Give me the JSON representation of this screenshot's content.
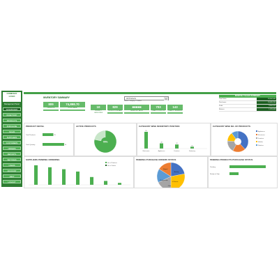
{
  "sidebar": {
    "logo_line1": "COMPANY",
    "logo_line2": "LOGO",
    "subtitle": "Management Panel",
    "items": [
      {
        "label": "DASHBOARD",
        "active": true
      },
      {
        "label": "INVENTORY"
      },
      {
        "label": "PRODUCTS"
      },
      {
        "label": "PURCHASE"
      },
      {
        "label": "SALES"
      },
      {
        "label": "SUPPLIERS"
      },
      {
        "label": "CUSTOMERS"
      },
      {
        "label": "ORDERS"
      },
      {
        "label": "REPORTS"
      },
      {
        "label": "SETTINGS"
      },
      {
        "label": "USERS"
      },
      {
        "label": "ACCOUNT"
      },
      {
        "label": "HELP"
      },
      {
        "label": "LOGOUT"
      }
    ]
  },
  "header": {
    "title": "INVENTORY SUMMARY",
    "select_value": "All Products",
    "select_sub": "Select Category / Product"
  },
  "kpis": [
    {
      "value": "809",
      "label": "PRODUCTS"
    },
    {
      "value": "74,898.70",
      "label": "STOCK VALUE"
    },
    {
      "value": "10",
      "label": "PRODUCT CATEGORIES"
    },
    {
      "value": "829",
      "label": "PRODUCTS ON HAND"
    },
    {
      "value": "■■■■■",
      "label": "INVENTORY VALUE"
    },
    {
      "value": "703",
      "label": "QUANTITY IN STOCK"
    },
    {
      "value": "143",
      "label": "QUANTITY RESERVED"
    }
  ],
  "summary": {
    "title": "MONTHLY SALES SUMMARY",
    "rows": [
      {
        "label": "Total Sales",
        "value": "28,484,346"
      },
      {
        "label": "Purchases",
        "value": "19,485,236"
      },
      {
        "label": "Profit",
        "value": "9,684,323"
      },
      {
        "label": "Returns",
        "value": "1,325,648"
      }
    ],
    "mini_label": "Trend"
  },
  "panels": {
    "product_detail": "PRODUCT DETAIL",
    "active_products": "ACTIVE PRODUCTS",
    "category_inventory": "CATEGORY WISE INVENTORY POSITION",
    "category_count": "CATEGORY WISE NO. OF PRODUCTS",
    "suppliers_pending": "SUPPLIERS PENDING ORDERING",
    "pending_purchase": "PENDING PURCHASE ORDERS STATUS",
    "pending_products": "PENDING PRODUCTS PURCHASE STATUS"
  },
  "chart_data": [
    {
      "type": "bar",
      "orientation": "horizontal",
      "title": "PRODUCT DETAIL",
      "categories": [
        "Total Products",
        "Total Quantity"
      ],
      "values": [
        25,
        50
      ],
      "xlim": [
        0,
        55
      ]
    },
    {
      "type": "pie",
      "title": "ACTIVE PRODUCTS",
      "labels": [
        "Active",
        "Inactive"
      ],
      "values": [
        78,
        22
      ],
      "center_label": "78%"
    },
    {
      "type": "bar",
      "title": "CATEGORY WISE INVENTORY POSITION",
      "categories": [
        "Electronics",
        "Appliances",
        "Furniture",
        "Stationery"
      ],
      "values": [
        90,
        28,
        22,
        10
      ]
    },
    {
      "type": "pie",
      "title": "CATEGORY WISE NO. OF PRODUCTS",
      "labels": [
        "Appliances",
        "Electronics",
        "Furniture",
        "Mobiles",
        "Watches"
      ],
      "values": [
        38,
        20,
        18,
        14,
        10
      ]
    },
    {
      "type": "bar",
      "title": "SUPPLIERS PENDING ORDERING",
      "series": [
        {
          "name": "No. of Products",
          "values": [
            100,
            90,
            80,
            68,
            40,
            20,
            10
          ]
        },
        {
          "name": "No. of Orders",
          "values": [
            0,
            0,
            0,
            0,
            0,
            0,
            0
          ]
        }
      ]
    },
    {
      "type": "pie",
      "title": "PENDING PURCHASE ORDERS STATUS",
      "labels": [
        "Shipped",
        "Awaiting",
        "Ready to ship",
        "In Process",
        "Other"
      ],
      "values": [
        22,
        28,
        18,
        16,
        16
      ]
    },
    {
      "type": "bar",
      "orientation": "horizontal",
      "title": "PENDING PRODUCTS PURCHASE STATUS",
      "categories": [
        "Pending",
        "Ready to Ship"
      ],
      "values": [
        100,
        25
      ],
      "xlim": [
        0,
        100
      ]
    }
  ],
  "colors": {
    "primary": "#2e7d32",
    "accent": "#4caf50",
    "dark": "#1b5e20",
    "pie": [
      "#4472c4",
      "#ed7d31",
      "#a5a5a5",
      "#ffc000",
      "#5b9bd5"
    ]
  }
}
